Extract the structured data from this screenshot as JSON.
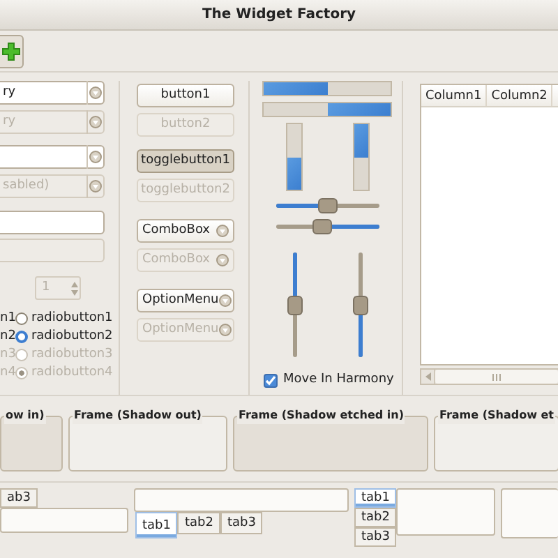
{
  "window": {
    "title": "The Widget Factory"
  },
  "column_1": {
    "combos": [
      {
        "value": "ry",
        "disabled": false
      },
      {
        "value": "ry",
        "disabled": true
      },
      {
        "disabled": false
      },
      {
        "value": "sabled)",
        "disabled": true
      }
    ],
    "entries": [
      {
        "disabled": false
      },
      {
        "disabled": true
      }
    ],
    "spin": {
      "value": "1",
      "disabled": true
    },
    "check_labels": [
      {
        "label": "n1",
        "disabled": false
      },
      {
        "label": "n2",
        "disabled": false
      },
      {
        "label": "n3",
        "disabled": true
      },
      {
        "label": "n4",
        "disabled": true
      }
    ],
    "radios": [
      {
        "label": "radiobutton1",
        "selected": false,
        "disabled": false
      },
      {
        "label": "radiobutton2",
        "selected": true,
        "disabled": false
      },
      {
        "label": "radiobutton3",
        "selected": false,
        "disabled": true
      },
      {
        "label": "radiobutton4",
        "selected": true,
        "disabled": true
      }
    ]
  },
  "column_2": {
    "controls": [
      {
        "kind": "button",
        "label": "button1",
        "disabled": false,
        "pressed": false
      },
      {
        "kind": "button",
        "label": "button2",
        "disabled": true,
        "pressed": false
      },
      {
        "kind": "toggle",
        "label": "togglebutton1",
        "disabled": false,
        "pressed": true
      },
      {
        "kind": "toggle",
        "label": "togglebutton2",
        "disabled": true,
        "pressed": false
      },
      {
        "kind": "combo",
        "label": "ComboBox",
        "disabled": false,
        "pressed": false
      },
      {
        "kind": "combo",
        "label": "ComboBox",
        "disabled": true,
        "pressed": false
      },
      {
        "kind": "option",
        "label": "OptionMenu",
        "disabled": false,
        "pressed": false
      },
      {
        "kind": "option",
        "label": "OptionMenu",
        "disabled": true,
        "pressed": false
      }
    ]
  },
  "column_3": {
    "horizontal_progress_bars": [
      {
        "inverted": false,
        "level": 0.5
      },
      {
        "inverted": true,
        "level": 0.5
      }
    ],
    "vertical_progress_bars": [
      {
        "inverted": true,
        "level": 0.5
      },
      {
        "inverted": false,
        "level": 0.5
      }
    ],
    "horizontal_scales": [
      {
        "inverted": false,
        "level": 0.5
      },
      {
        "inverted": true,
        "level": 0.55
      }
    ],
    "vertical_scales": [
      {
        "inverted": false,
        "level": 0.5
      },
      {
        "inverted": true,
        "level": 0.5
      }
    ],
    "harmony": {
      "label": "Move In Harmony",
      "checked": true
    }
  },
  "tree": {
    "columns": [
      "Column1",
      "Column2"
    ]
  },
  "frames": [
    {
      "label": "ow in)",
      "kind": "in"
    },
    {
      "label": "Frame (Shadow out)",
      "kind": "out"
    },
    {
      "label": "Frame (Shadow etched in)",
      "kind": "etched_in"
    },
    {
      "label": "Frame (Shadow et",
      "kind": "etched_out"
    }
  ],
  "top_tabs_notebook": {
    "tabs": [
      {
        "label": "ab3",
        "selected": false
      }
    ]
  },
  "bottom_tabs_notebook": {
    "tabs": [
      {
        "label": "tab1",
        "selected": true
      },
      {
        "label": "tab2",
        "selected": false
      },
      {
        "label": "tab3",
        "selected": false
      }
    ]
  },
  "left_tabs_notebook": {
    "tabs": [
      {
        "label": "tab1",
        "selected": true
      },
      {
        "label": "tab2",
        "selected": false
      },
      {
        "label": "tab3",
        "selected": false
      }
    ]
  }
}
